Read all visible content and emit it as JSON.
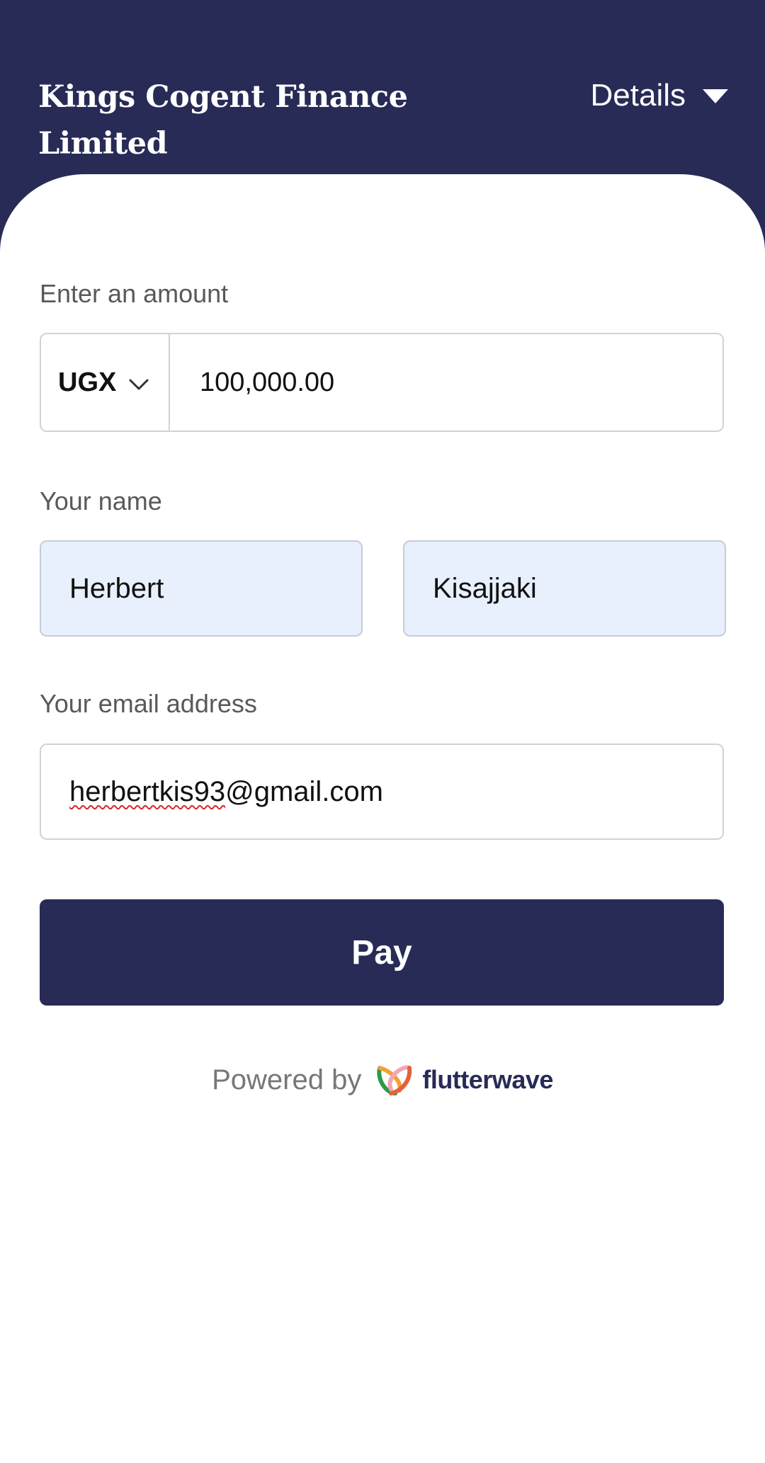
{
  "header": {
    "merchant_name_line1": "Kings Cogent Finance",
    "merchant_name_line2": "Limited",
    "details_label": "Details"
  },
  "form": {
    "amount": {
      "label": "Enter an amount",
      "currency": "UGX",
      "value": "100,000.00"
    },
    "name": {
      "label": "Your name",
      "first_name": "Herbert",
      "last_name": "Kisajjaki"
    },
    "email": {
      "label": "Your email address",
      "value_misspelled_part": "herbertkis93",
      "value_rest": "@gmail.com"
    },
    "pay_label": "Pay"
  },
  "footer": {
    "powered_by": "Powered by",
    "brand": "flutterwave",
    "logo_icon": "flutterwave-logo-icon"
  },
  "colors": {
    "primary": "#282b56",
    "autofill_bg": "#e8f0fd"
  }
}
